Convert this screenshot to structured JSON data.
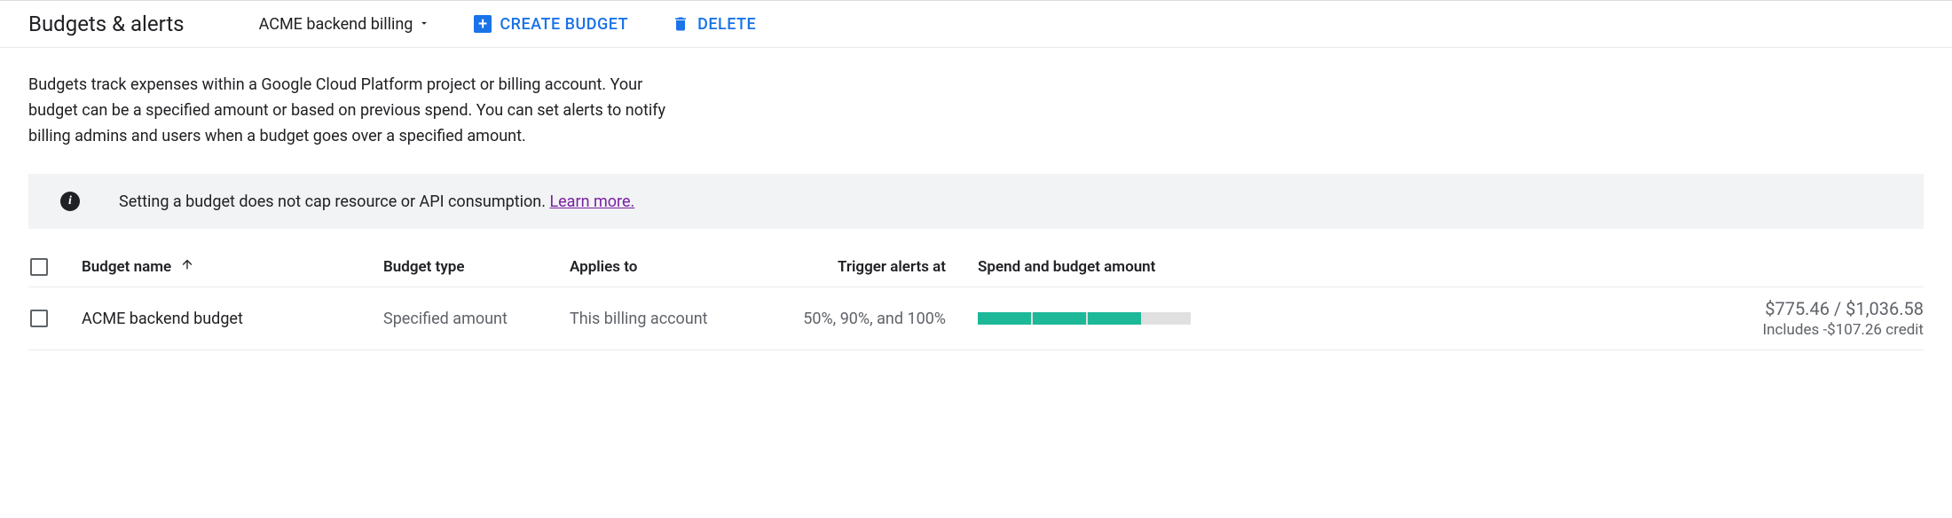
{
  "header": {
    "title": "Budgets & alerts",
    "account": "ACME backend billing",
    "create_label": "Create Budget",
    "delete_label": "Delete"
  },
  "description": "Budgets track expenses within a Google Cloud Platform project or billing account. Your budget can be a specified amount or based on previous spend. You can set alerts to notify billing admins and users when a budget goes over a specified amount.",
  "banner": {
    "text": "Setting a budget does not cap resource or API consumption. ",
    "link": "Learn more."
  },
  "table": {
    "columns": {
      "name": "Budget name",
      "type": "Budget type",
      "applies": "Applies to",
      "trigger": "Trigger alerts at",
      "spend": "Spend and budget amount"
    },
    "rows": [
      {
        "name": "ACME backend budget",
        "type": "Specified amount",
        "applies": "This billing account",
        "trigger": "50%, 90%, and 100%",
        "spend": "$775.46 / $1,036.58",
        "credit": "Includes -$107.26 credit",
        "progress_pct": 75
      }
    ]
  }
}
